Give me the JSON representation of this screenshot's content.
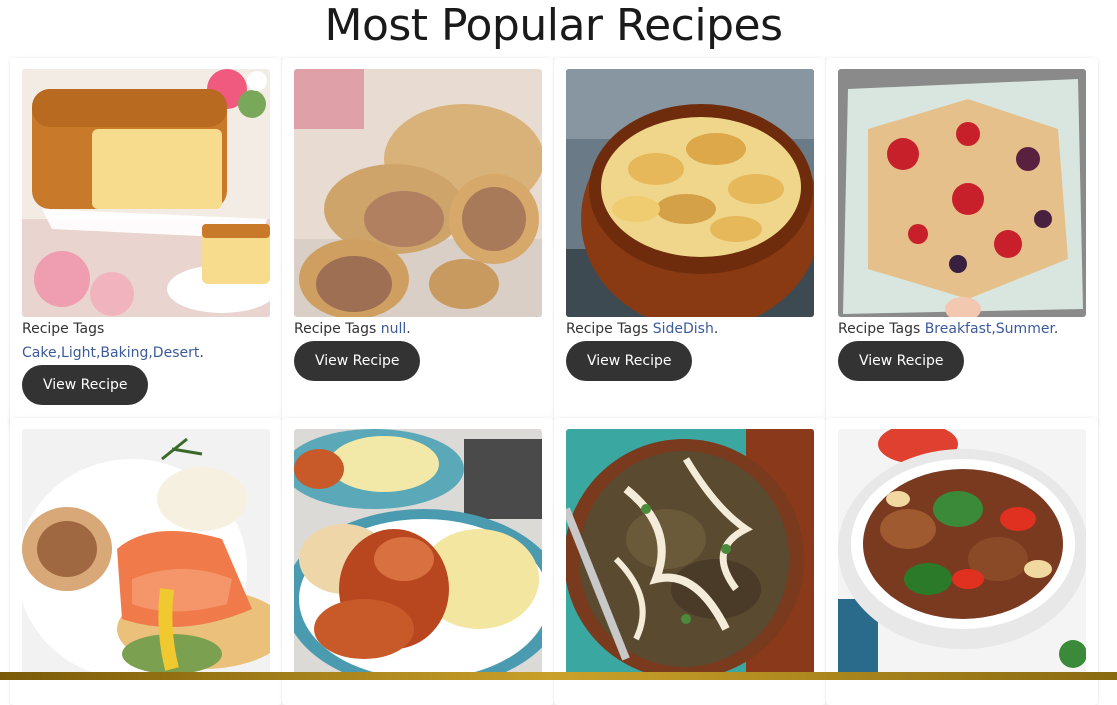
{
  "page": {
    "title": "Most Popular Recipes"
  },
  "recipes": [
    {
      "image": "lemon-pound-cake",
      "tags_prefix": "Recipe Tags ",
      "tags": "Cake,Light,Baking,Desert",
      "suffix": ".",
      "button_label": "View Recipe"
    },
    {
      "image": "sausage-rolls",
      "tags_prefix": "Recipe Tags ",
      "tags": "null",
      "suffix": ".",
      "button_label": "View Recipe"
    },
    {
      "image": "potato-bake",
      "tags_prefix": "Recipe Tags ",
      "tags": "SideDish",
      "suffix": ".",
      "button_label": "View Recipe"
    },
    {
      "image": "berry-pastries",
      "tags_prefix": "Recipe Tags ",
      "tags": "Breakfast,Summer",
      "suffix": ".",
      "button_label": "View Recipe"
    },
    {
      "image": "salmon-eggs-benedict"
    },
    {
      "image": "chicken-mash-plate"
    },
    {
      "image": "eggplant-lentil-dish"
    },
    {
      "image": "chicken-stir-fry-bowl"
    }
  ],
  "colors": {
    "button_bg": "#333333",
    "button_text": "#ffffff",
    "tag_link": "#3b5a9a",
    "bottom_bar": "#c9a12a"
  }
}
